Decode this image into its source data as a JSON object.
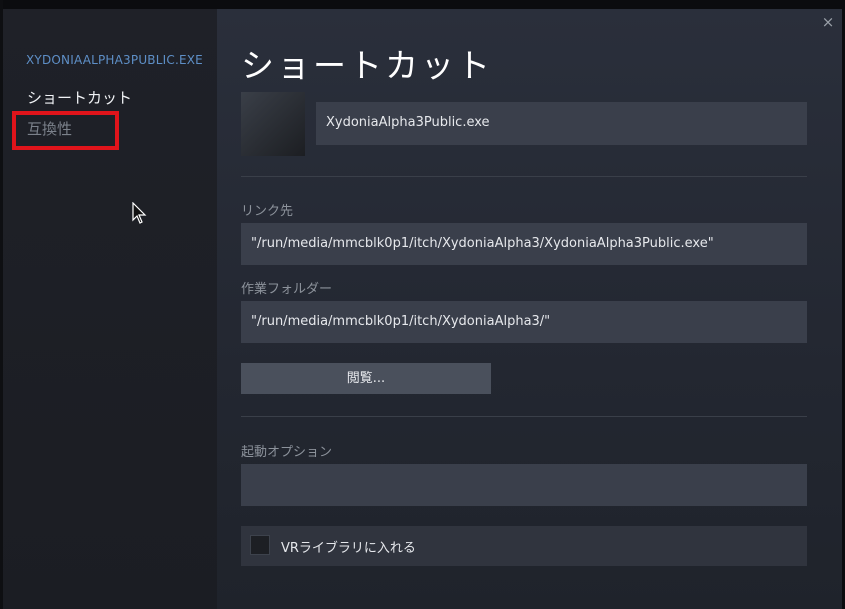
{
  "sidebar": {
    "title": "XYDONIAALPHA3PUBLIC.EXE",
    "items": [
      {
        "label": "ショートカット",
        "active": true
      },
      {
        "label": "互換性",
        "active": false
      }
    ]
  },
  "dialog": {
    "close_glyph": "×",
    "title": "ショートカット",
    "name_value": "XydoniaAlpha3Public.exe",
    "target_label": "リンク先",
    "target_value": "\"/run/media/mmcblk0p1/itch/XydoniaAlpha3/XydoniaAlpha3Public.exe\"",
    "start_in_label": "作業フォルダー",
    "start_in_value": "\"/run/media/mmcblk0p1/itch/XydoniaAlpha3/\"",
    "browse_label": "閲覧...",
    "launch_options_label": "起動オプション",
    "launch_options_value": "",
    "vr_library_label": "VRライブラリに入れる",
    "vr_library_checked": false
  },
  "colors": {
    "highlight": "#e0141b",
    "accent": "#5e8fc7"
  },
  "icons": {
    "close": "close-icon",
    "cursor": "mouse-cursor-icon"
  }
}
